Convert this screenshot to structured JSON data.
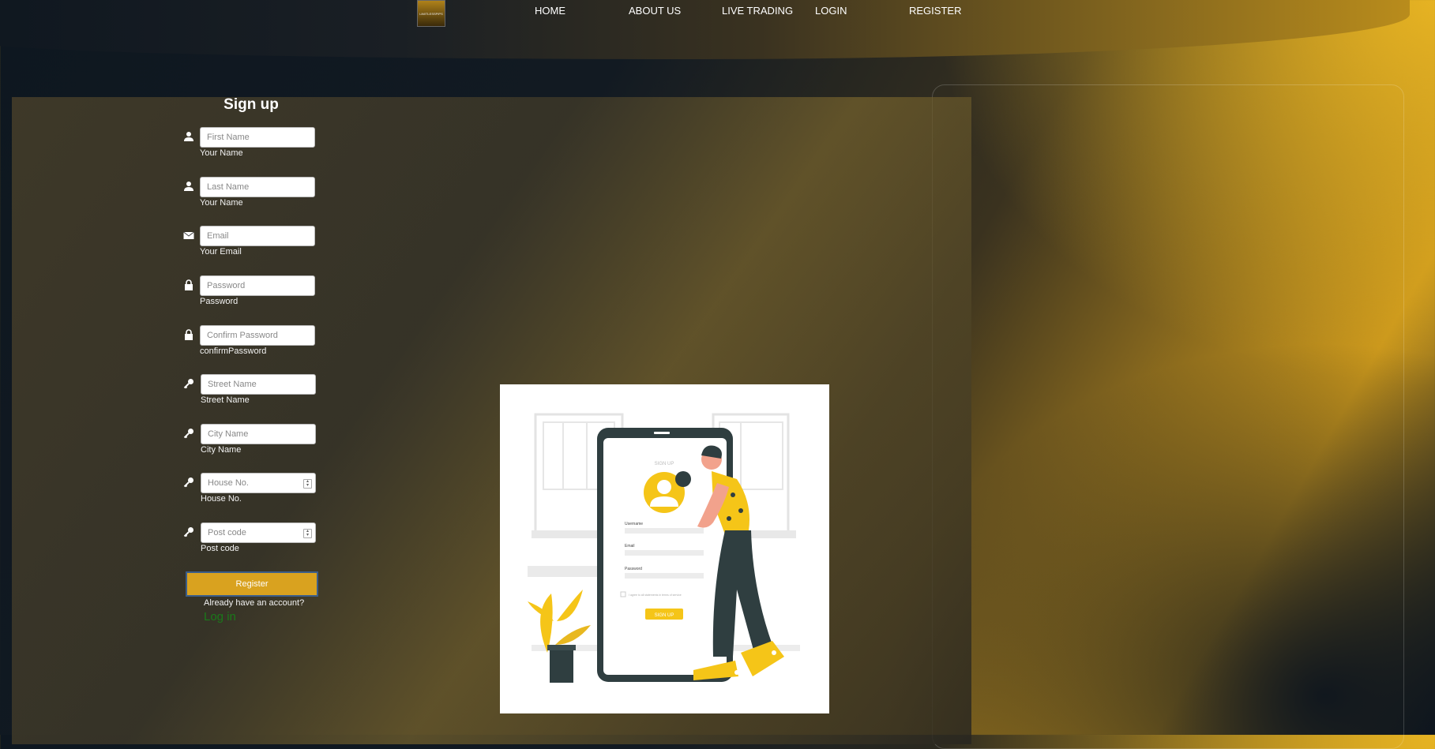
{
  "brand": {
    "logo_text": "LIMITLESSPIPS"
  },
  "nav": {
    "items": [
      {
        "label": "HOME"
      },
      {
        "label": "ABOUT US"
      },
      {
        "label": "LIVE TRADING"
      },
      {
        "label": "LOGIN"
      },
      {
        "label": "REGISTER"
      }
    ]
  },
  "form": {
    "title": "Sign up",
    "fields": [
      {
        "icon": "user-icon",
        "placeholder": "First Name",
        "label": "Your Name"
      },
      {
        "icon": "user-icon",
        "placeholder": "Last Name",
        "label": "Your Name"
      },
      {
        "icon": "envelope-icon",
        "placeholder": "Email",
        "label": "Your Email"
      },
      {
        "icon": "lock-icon",
        "placeholder": "Password",
        "label": "Password"
      },
      {
        "icon": "lock-icon",
        "placeholder": "Confirm Password",
        "label": "confirmPassword"
      },
      {
        "icon": "key-icon",
        "placeholder": "Street Name",
        "label": "Street Name"
      },
      {
        "icon": "key-icon",
        "placeholder": "City Name",
        "label": "City Name"
      },
      {
        "icon": "key-icon",
        "placeholder": "House No.",
        "label": "House No."
      },
      {
        "icon": "key-icon",
        "placeholder": "Post code",
        "label": "Post code"
      }
    ],
    "register_label": "Register",
    "already_text": "Already have an account?",
    "login_link": "Log in"
  },
  "illustration": {
    "screen_title": "SIGN UP",
    "username_label": "Username",
    "email_label": "Email",
    "password_label": "Password",
    "terms_text": "I agree to all statements in terms of service",
    "button_label": "SIGN UP"
  },
  "colors": {
    "accent": "#d9a21f",
    "login_link": "#1a7a1a",
    "illustration_yellow": "#f5c518",
    "illustration_dark": "#2f3e40"
  }
}
